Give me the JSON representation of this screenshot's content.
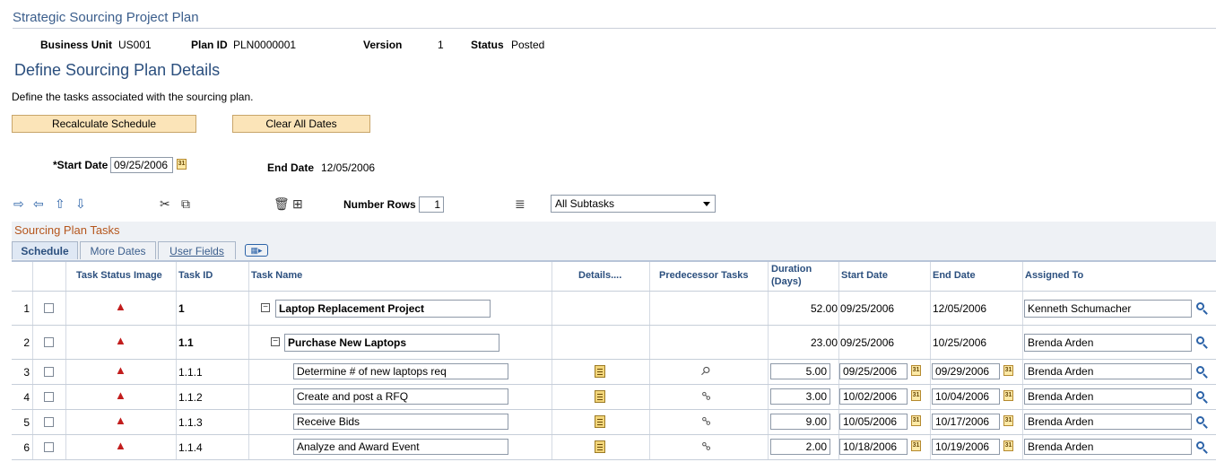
{
  "page": {
    "title": "Strategic Sourcing Project Plan",
    "header": {
      "business_unit_label": "Business Unit",
      "business_unit_value": "US001",
      "plan_id_label": "Plan ID",
      "plan_id_value": "PLN0000001",
      "version_label": "Version",
      "version_value": "1",
      "status_label": "Status",
      "status_value": "Posted"
    },
    "section_title": "Define Sourcing Plan Details",
    "instructions": "Define the tasks associated with the sourcing plan."
  },
  "buttons": {
    "recalculate": "Recalculate Schedule",
    "clear_dates": "Clear All Dates"
  },
  "dates": {
    "start_label": "*Start Date",
    "start_value": "09/25/2006",
    "end_label": "End Date",
    "end_value": "12/05/2006"
  },
  "toolbar": {
    "icons": [
      "arrow-right-icon",
      "arrow-left-icon",
      "arrow-up-icon",
      "arrow-down-icon",
      "cut-icon",
      "copy-icon",
      "delete-icon",
      "insert-row-icon",
      "add-subtask-icon"
    ],
    "number_rows_label": "Number Rows",
    "number_rows_value": "1",
    "subtask_filter_selected": "All Subtasks"
  },
  "grid": {
    "title": "Sourcing Plan Tasks",
    "tabs": [
      {
        "label": "Schedule",
        "active": true
      },
      {
        "label": "More Dates",
        "active": false
      },
      {
        "label": "User Fields",
        "active": false
      }
    ],
    "columns": {
      "task_status_image": "Task Status Image",
      "task_id": "Task ID",
      "task_name": "Task Name",
      "details": "Details....",
      "predecessor": "Predecessor Tasks",
      "duration_line1": "Duration",
      "duration_line2": "(Days)",
      "start_date": "Start Date",
      "end_date": "End Date",
      "assigned_to": "Assigned To"
    },
    "rows": [
      {
        "num": "1",
        "task_id": "1",
        "task_name": "Laptop Replacement Project",
        "duration": "52.00",
        "start": "09/25/2006",
        "end": "12/05/2006",
        "assigned": "Kenneth Schumacher",
        "level": 0
      },
      {
        "num": "2",
        "task_id": "1.1",
        "task_name": "Purchase New Laptops",
        "duration": "23.00",
        "start": "09/25/2006",
        "end": "10/25/2006",
        "assigned": "Brenda Arden",
        "level": 1
      },
      {
        "num": "3",
        "task_id": "1.1.1",
        "task_name": "Determine # of new laptops req",
        "duration": "5.00",
        "start": "09/25/2006",
        "end": "09/29/2006",
        "assigned": "Brenda Arden",
        "level": 2
      },
      {
        "num": "4",
        "task_id": "1.1.2",
        "task_name": "Create and post a RFQ",
        "duration": "3.00",
        "start": "10/02/2006",
        "end": "10/04/2006",
        "assigned": "Brenda Arden",
        "level": 2
      },
      {
        "num": "5",
        "task_id": "1.1.3",
        "task_name": "Receive Bids",
        "duration": "9.00",
        "start": "10/05/2006",
        "end": "10/17/2006",
        "assigned": "Brenda Arden",
        "level": 2
      },
      {
        "num": "6",
        "task_id": "1.1.4",
        "task_name": "Analyze and Award Event",
        "duration": "2.00",
        "start": "10/18/2006",
        "end": "10/19/2006",
        "assigned": "Brenda Arden",
        "level": 2
      }
    ]
  }
}
